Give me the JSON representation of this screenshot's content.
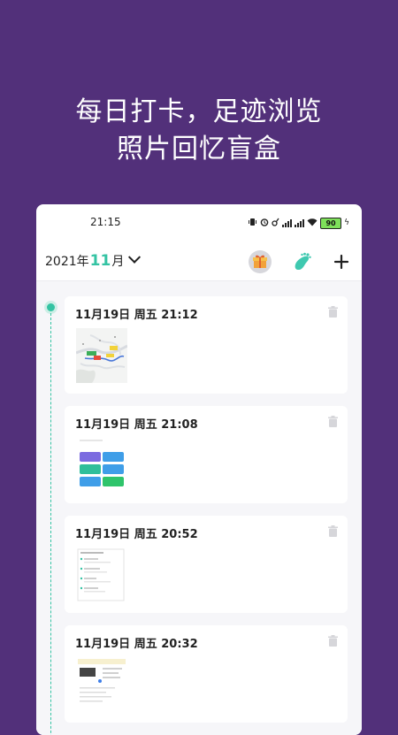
{
  "headline": {
    "line1": "每日打卡，足迹浏览",
    "line2": "照片回忆盲盒"
  },
  "status_bar": {
    "time": "21:15",
    "battery": "90"
  },
  "header": {
    "year": "2021年",
    "month": "11",
    "month_unit": "月"
  },
  "entries": [
    {
      "date": "11月19日 周五 21:12",
      "thumb": "map-screenshot"
    },
    {
      "date": "11月19日 周五 21:08",
      "thumb": "tiles-screenshot"
    },
    {
      "date": "11月19日 周五 20:52",
      "thumb": "list-screenshot"
    },
    {
      "date": "11月19日 周五 20:32",
      "thumb": "calendar-screenshot"
    }
  ],
  "colors": {
    "background": "#52307a",
    "accent": "#34c3a3"
  }
}
